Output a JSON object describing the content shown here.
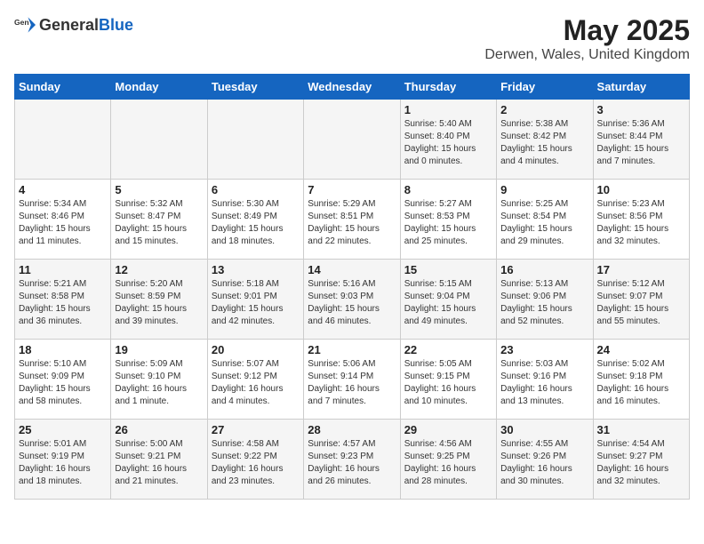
{
  "header": {
    "logo_general": "General",
    "logo_blue": "Blue",
    "title": "May 2025",
    "subtitle": "Derwen, Wales, United Kingdom"
  },
  "days_of_week": [
    "Sunday",
    "Monday",
    "Tuesday",
    "Wednesday",
    "Thursday",
    "Friday",
    "Saturday"
  ],
  "weeks": [
    [
      {
        "day": "",
        "text": ""
      },
      {
        "day": "",
        "text": ""
      },
      {
        "day": "",
        "text": ""
      },
      {
        "day": "",
        "text": ""
      },
      {
        "day": "1",
        "text": "Sunrise: 5:40 AM\nSunset: 8:40 PM\nDaylight: 15 hours\nand 0 minutes."
      },
      {
        "day": "2",
        "text": "Sunrise: 5:38 AM\nSunset: 8:42 PM\nDaylight: 15 hours\nand 4 minutes."
      },
      {
        "day": "3",
        "text": "Sunrise: 5:36 AM\nSunset: 8:44 PM\nDaylight: 15 hours\nand 7 minutes."
      }
    ],
    [
      {
        "day": "4",
        "text": "Sunrise: 5:34 AM\nSunset: 8:46 PM\nDaylight: 15 hours\nand 11 minutes."
      },
      {
        "day": "5",
        "text": "Sunrise: 5:32 AM\nSunset: 8:47 PM\nDaylight: 15 hours\nand 15 minutes."
      },
      {
        "day": "6",
        "text": "Sunrise: 5:30 AM\nSunset: 8:49 PM\nDaylight: 15 hours\nand 18 minutes."
      },
      {
        "day": "7",
        "text": "Sunrise: 5:29 AM\nSunset: 8:51 PM\nDaylight: 15 hours\nand 22 minutes."
      },
      {
        "day": "8",
        "text": "Sunrise: 5:27 AM\nSunset: 8:53 PM\nDaylight: 15 hours\nand 25 minutes."
      },
      {
        "day": "9",
        "text": "Sunrise: 5:25 AM\nSunset: 8:54 PM\nDaylight: 15 hours\nand 29 minutes."
      },
      {
        "day": "10",
        "text": "Sunrise: 5:23 AM\nSunset: 8:56 PM\nDaylight: 15 hours\nand 32 minutes."
      }
    ],
    [
      {
        "day": "11",
        "text": "Sunrise: 5:21 AM\nSunset: 8:58 PM\nDaylight: 15 hours\nand 36 minutes."
      },
      {
        "day": "12",
        "text": "Sunrise: 5:20 AM\nSunset: 8:59 PM\nDaylight: 15 hours\nand 39 minutes."
      },
      {
        "day": "13",
        "text": "Sunrise: 5:18 AM\nSunset: 9:01 PM\nDaylight: 15 hours\nand 42 minutes."
      },
      {
        "day": "14",
        "text": "Sunrise: 5:16 AM\nSunset: 9:03 PM\nDaylight: 15 hours\nand 46 minutes."
      },
      {
        "day": "15",
        "text": "Sunrise: 5:15 AM\nSunset: 9:04 PM\nDaylight: 15 hours\nand 49 minutes."
      },
      {
        "day": "16",
        "text": "Sunrise: 5:13 AM\nSunset: 9:06 PM\nDaylight: 15 hours\nand 52 minutes."
      },
      {
        "day": "17",
        "text": "Sunrise: 5:12 AM\nSunset: 9:07 PM\nDaylight: 15 hours\nand 55 minutes."
      }
    ],
    [
      {
        "day": "18",
        "text": "Sunrise: 5:10 AM\nSunset: 9:09 PM\nDaylight: 15 hours\nand 58 minutes."
      },
      {
        "day": "19",
        "text": "Sunrise: 5:09 AM\nSunset: 9:10 PM\nDaylight: 16 hours\nand 1 minute."
      },
      {
        "day": "20",
        "text": "Sunrise: 5:07 AM\nSunset: 9:12 PM\nDaylight: 16 hours\nand 4 minutes."
      },
      {
        "day": "21",
        "text": "Sunrise: 5:06 AM\nSunset: 9:14 PM\nDaylight: 16 hours\nand 7 minutes."
      },
      {
        "day": "22",
        "text": "Sunrise: 5:05 AM\nSunset: 9:15 PM\nDaylight: 16 hours\nand 10 minutes."
      },
      {
        "day": "23",
        "text": "Sunrise: 5:03 AM\nSunset: 9:16 PM\nDaylight: 16 hours\nand 13 minutes."
      },
      {
        "day": "24",
        "text": "Sunrise: 5:02 AM\nSunset: 9:18 PM\nDaylight: 16 hours\nand 16 minutes."
      }
    ],
    [
      {
        "day": "25",
        "text": "Sunrise: 5:01 AM\nSunset: 9:19 PM\nDaylight: 16 hours\nand 18 minutes."
      },
      {
        "day": "26",
        "text": "Sunrise: 5:00 AM\nSunset: 9:21 PM\nDaylight: 16 hours\nand 21 minutes."
      },
      {
        "day": "27",
        "text": "Sunrise: 4:58 AM\nSunset: 9:22 PM\nDaylight: 16 hours\nand 23 minutes."
      },
      {
        "day": "28",
        "text": "Sunrise: 4:57 AM\nSunset: 9:23 PM\nDaylight: 16 hours\nand 26 minutes."
      },
      {
        "day": "29",
        "text": "Sunrise: 4:56 AM\nSunset: 9:25 PM\nDaylight: 16 hours\nand 28 minutes."
      },
      {
        "day": "30",
        "text": "Sunrise: 4:55 AM\nSunset: 9:26 PM\nDaylight: 16 hours\nand 30 minutes."
      },
      {
        "day": "31",
        "text": "Sunrise: 4:54 AM\nSunset: 9:27 PM\nDaylight: 16 hours\nand 32 minutes."
      }
    ]
  ]
}
